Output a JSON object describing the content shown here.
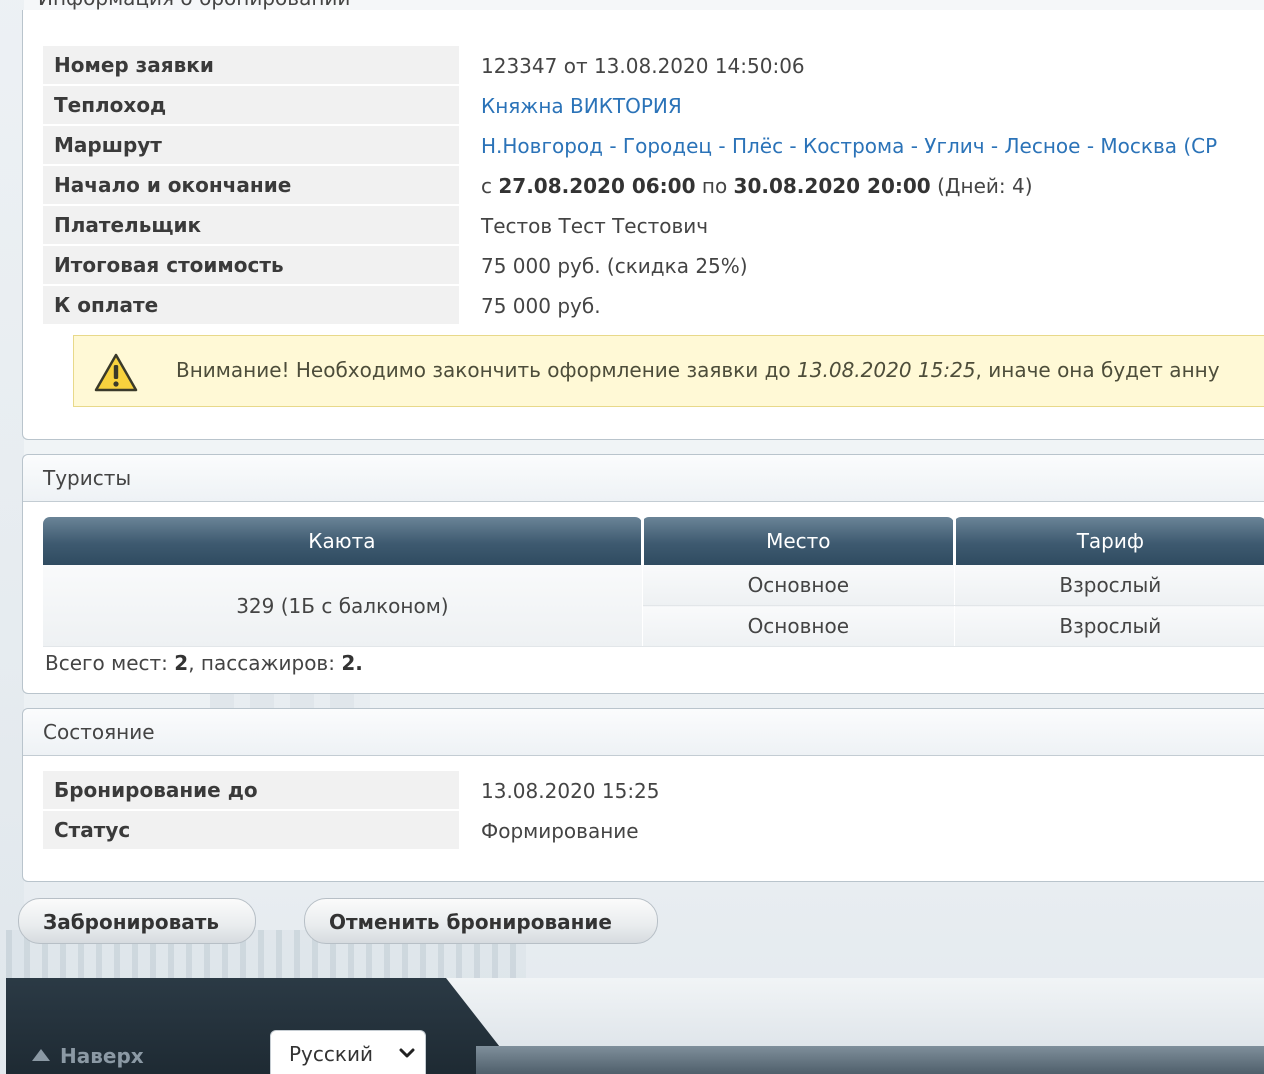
{
  "top_title": "Информация о бронировании",
  "info": {
    "rows": [
      {
        "label": "Номер заявки",
        "value": "123347 от 13.08.2020 14:50:06"
      },
      {
        "label": "Теплоход",
        "value": "Княжна ВИКТОРИЯ"
      },
      {
        "label": "Маршрут",
        "value": "Н.Новгород - Городец - Плёс - Кострома - Углич - Лесное - Москва (СР"
      },
      {
        "label": "Начало и окончание",
        "prefix": "с",
        "start": "27.08.2020 06:00",
        "mid": "по",
        "end": "30.08.2020 20:00",
        "days": "(Дней: 4)"
      },
      {
        "label": "Плательщик",
        "value": "Тестов Тест Тестович"
      },
      {
        "label": "Итоговая стоимость",
        "value": "75 000 руб. (скидка 25%)"
      },
      {
        "label": "К оплате",
        "value": "75 000 руб."
      }
    ],
    "warning": {
      "text_before": "Внимание! Необходимо закончить оформление заявки до",
      "deadline": "13.08.2020 15:25",
      "text_after": ", иначе она будет анну",
      "icon": "warning-icon"
    }
  },
  "tourists": {
    "title": "Туристы",
    "columns": [
      "Каюта",
      "Место",
      "Тариф"
    ],
    "cabin": "329 (1Б с балконом)",
    "rows": [
      {
        "place": "Основное",
        "tariff": "Взрослый"
      },
      {
        "place": "Основное",
        "tariff": "Взрослый"
      }
    ],
    "summary": {
      "seats_label": "Всего мест:",
      "seats": "2",
      "passengers_label": ", пассажиров:",
      "passengers": "2",
      "end": "."
    }
  },
  "status": {
    "title": "Состояние",
    "rows": [
      {
        "label": "Бронирование до",
        "value": "13.08.2020 15:25"
      },
      {
        "label": "Статус",
        "value": "Формирование"
      }
    ]
  },
  "buttons": {
    "book": "Забронировать",
    "cancel": "Отменить бронирование"
  },
  "footer": {
    "to_top": "Наверх",
    "language": "Русский"
  },
  "colors": {
    "link": "#2b73b8",
    "header_dark": "#2f4b60",
    "warning_bg": "#fff9d6"
  }
}
